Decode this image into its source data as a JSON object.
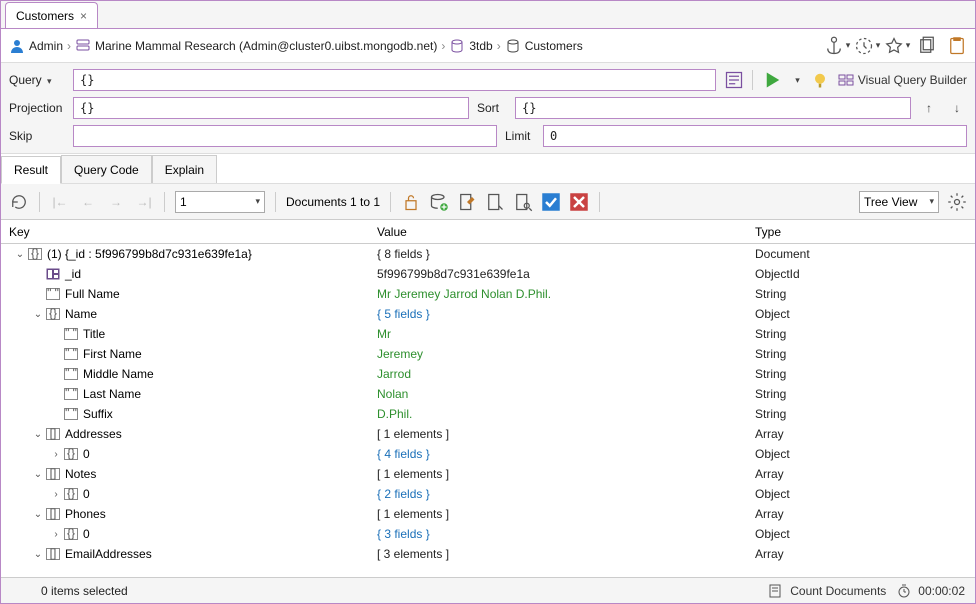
{
  "tab": {
    "title": "Customers"
  },
  "breadcrumb": {
    "user": "Admin",
    "connection": "Marine Mammal Research (Admin@cluster0.uibst.mongodb.net)",
    "database": "3tdb",
    "collection": "Customers"
  },
  "query": {
    "label": "Query",
    "value": "{}",
    "projection_label": "Projection",
    "projection_value": "{}",
    "sort_label": "Sort",
    "sort_value": "{}",
    "skip_label": "Skip",
    "skip_value": "",
    "limit_label": "Limit",
    "limit_value": "0",
    "vqb": "Visual Query Builder"
  },
  "subtabs": {
    "result": "Result",
    "querycode": "Query Code",
    "explain": "Explain"
  },
  "toolbar": {
    "page": "1",
    "docrange": "Documents 1 to 1",
    "view": "Tree View"
  },
  "headers": {
    "key": "Key",
    "value": "Value",
    "type": "Type"
  },
  "rows": [
    {
      "indent": 0,
      "twisty": "open",
      "icon": "obj",
      "key": "(1) {_id : 5f996799b8d7c931e639fe1a}",
      "val": "{ 8 fields }",
      "vclass": "",
      "type": "Document"
    },
    {
      "indent": 1,
      "twisty": "",
      "icon": "id",
      "key": "_id",
      "val": "5f996799b8d7c931e639fe1a",
      "vclass": "",
      "type": "ObjectId"
    },
    {
      "indent": 1,
      "twisty": "",
      "icon": "str",
      "key": "Full Name",
      "val": "Mr Jeremey Jarrod Nolan D.Phil.",
      "vclass": "green",
      "type": "String"
    },
    {
      "indent": 1,
      "twisty": "open",
      "icon": "obj",
      "key": "Name",
      "val": "{ 5 fields }",
      "vclass": "blue",
      "type": "Object"
    },
    {
      "indent": 2,
      "twisty": "",
      "icon": "str",
      "key": "Title",
      "val": "Mr",
      "vclass": "green",
      "type": "String"
    },
    {
      "indent": 2,
      "twisty": "",
      "icon": "str",
      "key": "First Name",
      "val": "Jeremey",
      "vclass": "green",
      "type": "String"
    },
    {
      "indent": 2,
      "twisty": "",
      "icon": "str",
      "key": "Middle Name",
      "val": "Jarrod",
      "vclass": "green",
      "type": "String"
    },
    {
      "indent": 2,
      "twisty": "",
      "icon": "str",
      "key": "Last Name",
      "val": "Nolan",
      "vclass": "green",
      "type": "String"
    },
    {
      "indent": 2,
      "twisty": "",
      "icon": "str",
      "key": "Suffix",
      "val": "D.Phil.",
      "vclass": "green",
      "type": "String"
    },
    {
      "indent": 1,
      "twisty": "open",
      "icon": "arr",
      "key": "Addresses",
      "val": "[ 1 elements ]",
      "vclass": "",
      "type": "Array"
    },
    {
      "indent": 2,
      "twisty": "closed",
      "icon": "obj",
      "key": "0",
      "val": "{ 4 fields }",
      "vclass": "blue",
      "type": "Object"
    },
    {
      "indent": 1,
      "twisty": "open",
      "icon": "arr",
      "key": "Notes",
      "val": "[ 1 elements ]",
      "vclass": "",
      "type": "Array"
    },
    {
      "indent": 2,
      "twisty": "closed",
      "icon": "obj",
      "key": "0",
      "val": "{ 2 fields }",
      "vclass": "blue",
      "type": "Object"
    },
    {
      "indent": 1,
      "twisty": "open",
      "icon": "arr",
      "key": "Phones",
      "val": "[ 1 elements ]",
      "vclass": "",
      "type": "Array"
    },
    {
      "indent": 2,
      "twisty": "closed",
      "icon": "obj",
      "key": "0",
      "val": "{ 3 fields }",
      "vclass": "blue",
      "type": "Object"
    },
    {
      "indent": 1,
      "twisty": "open",
      "icon": "arr",
      "key": "EmailAddresses",
      "val": "[ 3 elements ]",
      "vclass": "",
      "type": "Array"
    }
  ],
  "status": {
    "selected": "0 items selected",
    "count": "Count Documents",
    "time": "00:00:02"
  }
}
